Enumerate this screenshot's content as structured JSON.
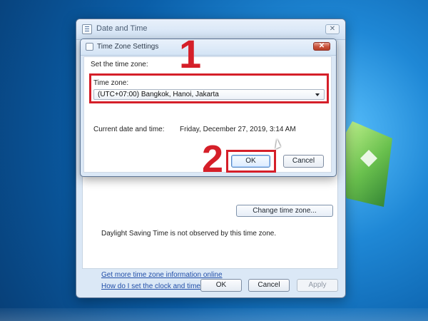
{
  "desktop": {
    "background_colors": [
      "#5cc3ff",
      "#1f88d6",
      "#0a5ea8",
      "#083f77"
    ]
  },
  "date_time_window": {
    "title": "Date and Time",
    "close_symbol": "✕",
    "change_time_zone_label": "Change time zone...",
    "dst_text": "Daylight Saving Time is not observed by this time zone.",
    "links": [
      "Get more time zone information online",
      "How do I set the clock and time zone?"
    ],
    "buttons": {
      "ok": "OK",
      "cancel": "Cancel",
      "apply": "Apply"
    }
  },
  "time_zone_dialog": {
    "title": "Time Zone Settings",
    "close_symbol": "✕",
    "prompt": "Set the time zone:",
    "time_zone_label": "Time zone:",
    "selected_time_zone": "(UTC+07:00) Bangkok, Hanoi, Jakarta",
    "current_label": "Current date and time:",
    "current_value": "Friday, December 27, 2019, 3:14 AM",
    "buttons": {
      "ok": "OK",
      "cancel": "Cancel"
    }
  },
  "annotations": {
    "step_1": "1",
    "step_2": "2",
    "highlight_color": "#d51f29"
  },
  "icons": {
    "window_icon": "date-time-window-icon",
    "dialog_icon": "time-zone-settings-icon",
    "dropdown_icon": "chevron-down-icon",
    "pointer_icon": "mouse-pointer-icon"
  }
}
